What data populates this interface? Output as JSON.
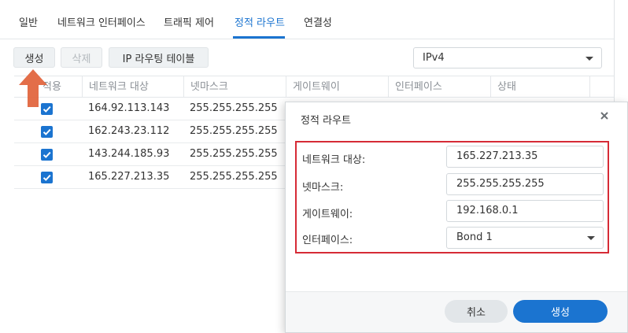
{
  "tabs": [
    {
      "label": "일반"
    },
    {
      "label": "네트워크 인터페이스"
    },
    {
      "label": "트래픽 제어"
    },
    {
      "label": "정적 라우트"
    },
    {
      "label": "연결성"
    }
  ],
  "active_tab": "정적 라우트",
  "toolbar": {
    "create": "생성",
    "delete": "삭제",
    "ip_routing_table": "IP 라우팅 테이블",
    "ip_version": "IPv4"
  },
  "table": {
    "columns": [
      "적용",
      "네트워크 대상",
      "넷마스크",
      "게이트웨이",
      "인터페이스",
      "상태"
    ],
    "rows": [
      {
        "applied": true,
        "destination": "164.92.113.143",
        "netmask": "255.255.255.255"
      },
      {
        "applied": true,
        "destination": "162.243.23.112",
        "netmask": "255.255.255.255"
      },
      {
        "applied": true,
        "destination": "143.244.185.93",
        "netmask": "255.255.255.255"
      },
      {
        "applied": true,
        "destination": "165.227.213.35",
        "netmask": "255.255.255.255"
      }
    ]
  },
  "dialog": {
    "title": "정적 라우트",
    "fields": {
      "destination_label": "네트워크 대상:",
      "destination_value": "165.227.213.35",
      "netmask_label": "넷마스크:",
      "netmask_value": "255.255.255.255",
      "gateway_label": "게이트웨이:",
      "gateway_value": "192.168.0.1",
      "interface_label": "인터페이스:",
      "interface_value": "Bond 1"
    },
    "cancel": "취소",
    "create": "생성"
  },
  "colors": {
    "accent": "#1b74d0",
    "highlight_border": "#d62b36",
    "arrow": "#e2663f"
  }
}
